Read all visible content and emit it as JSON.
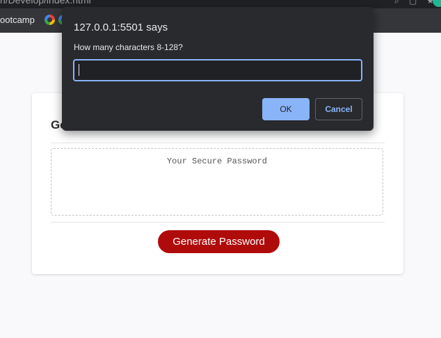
{
  "browser": {
    "url_fragment": "ri/Develop/index.html",
    "bookmark_label": "ootcamp"
  },
  "page": {
    "card_title": "Ge",
    "password_placeholder": "Your Secure Password",
    "generate_label": "Generate Password"
  },
  "dialog": {
    "title": "127.0.0.1:5501 says",
    "message": "How many characters 8-128?",
    "input_value": "",
    "ok_label": "OK",
    "cancel_label": "Cancel"
  },
  "colors": {
    "button_red": "#b00b0b",
    "dialog_bg": "#292a2d",
    "accent_blue": "#8ab4f8"
  }
}
